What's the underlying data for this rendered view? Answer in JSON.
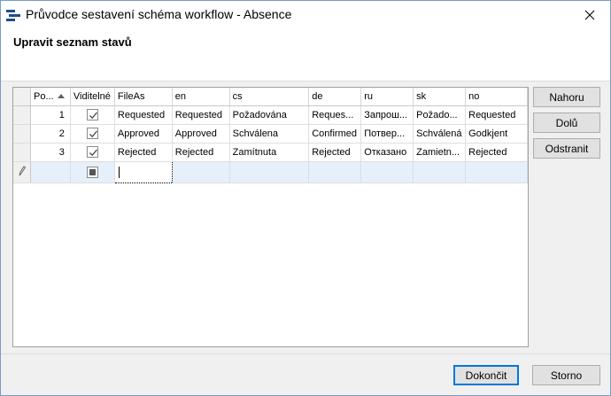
{
  "window": {
    "title": "Průvodce sestavení schéma workflow - Absence"
  },
  "header": {
    "title": "Upravit seznam stavů"
  },
  "grid": {
    "columns": [
      "Po...",
      "Viditelné",
      "FileAs",
      "en",
      "cs",
      "de",
      "ru",
      "sk",
      "no"
    ],
    "rows": [
      {
        "order": "1",
        "visible": true,
        "fileas": "Requested",
        "en": "Requested",
        "cs": "Požadována",
        "de": "Reques...",
        "ru": "Запрош...",
        "sk": "Požado...",
        "no": "Requested"
      },
      {
        "order": "2",
        "visible": true,
        "fileas": "Approved",
        "en": "Approved",
        "cs": "Schválena",
        "de": "Confirmed",
        "ru": "Потвер...",
        "sk": "Schválená",
        "no": "Godkjent"
      },
      {
        "order": "3",
        "visible": true,
        "fileas": "Rejected",
        "en": "Rejected",
        "cs": "Zamítnuta",
        "de": "Rejected",
        "ru": "Отказано",
        "sk": "Zamietn...",
        "no": "Rejected"
      }
    ]
  },
  "side_buttons": {
    "up": "Nahoru",
    "down": "Dolů",
    "remove": "Odstranit"
  },
  "footer": {
    "finish": "Dokončit",
    "cancel": "Storno"
  }
}
